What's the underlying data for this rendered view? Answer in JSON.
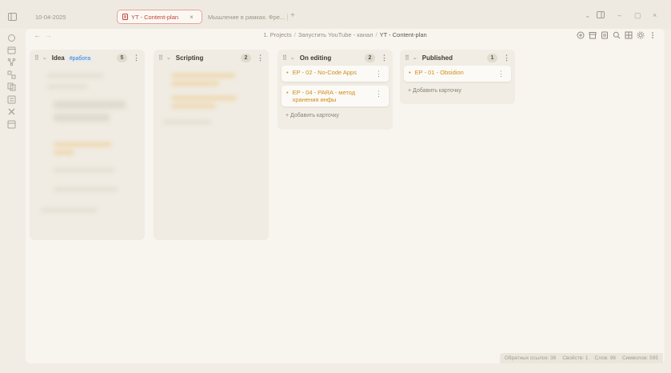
{
  "tabs": [
    {
      "label": "10-04-2025",
      "active": false
    },
    {
      "label": "YT - Content-plan",
      "active": true
    },
    {
      "label": "Мышление в рамках. Фре...",
      "active": false
    }
  ],
  "new_tab": "+",
  "window_controls": [
    "⌄",
    "▢",
    "–",
    "▢",
    "×"
  ],
  "breadcrumb": {
    "items": [
      "1. Projects",
      "Запустить YouTube - канал"
    ],
    "separator": "/",
    "current": "YT - Content-plan"
  },
  "nav": {
    "back": "←",
    "forward": "→"
  },
  "lanes": [
    {
      "title": "Idea",
      "tag": "#работа",
      "count": "5",
      "cards": [],
      "blurred": true
    },
    {
      "title": "Scripting",
      "tag": "",
      "count": "2",
      "cards": [],
      "blurred": true
    },
    {
      "title": "On editing",
      "tag": "",
      "count": "2",
      "cards": [
        "EP - 02 - No-Code Apps",
        "EP - 04 - PARA - метод хранения инфы"
      ],
      "add_label": "+ Добавить карточку"
    },
    {
      "title": "Published",
      "tag": "",
      "count": "1",
      "cards": [
        "EP - 01 - Obsidion"
      ],
      "add_label": "+ Добавить карточку"
    }
  ],
  "status_bar": [
    "Обратных ссылок: 36",
    "Свойств: 1",
    "Слов: 96",
    "Символов: 595"
  ],
  "colors": {
    "accent_active_tab": "#c0453a",
    "card_link": "#cc8f1c",
    "tag": "#3c7fc1"
  }
}
